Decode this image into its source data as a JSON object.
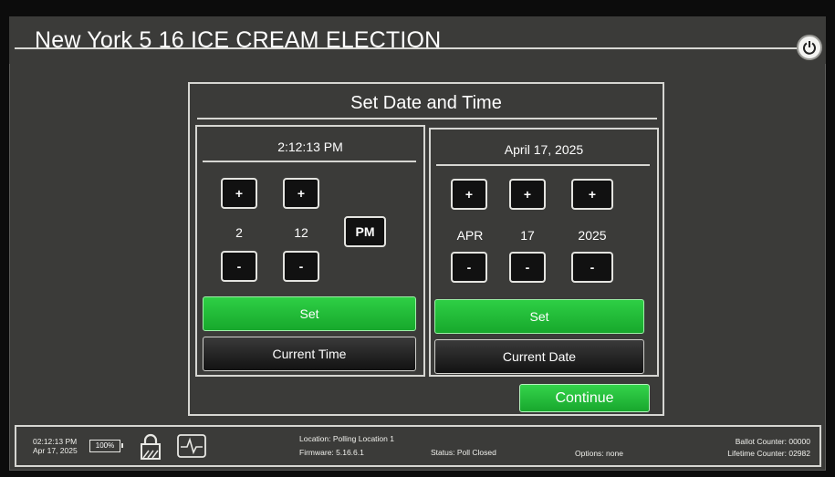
{
  "header": {
    "title": "New York 5 16 ICE CREAM ELECTION",
    "power_icon": "power-icon"
  },
  "dialog": {
    "title": "Set Date and Time",
    "time_panel": {
      "current_value": "2:12:13 PM",
      "hour": "2",
      "minute": "12",
      "ampm": "PM",
      "plus_label": "+",
      "minus_label": "-",
      "set_label": "Set",
      "current_label": "Current Time"
    },
    "date_panel": {
      "current_value": "April 17, 2025",
      "month": "APR",
      "day": "17",
      "year": "2025",
      "plus_label": "+",
      "minus_label": "-",
      "set_label": "Set",
      "current_label": "Current Date"
    },
    "continue_label": "Continue"
  },
  "status_bar": {
    "time": "02:12:13 PM",
    "date": "Apr 17, 2025",
    "battery": "100%",
    "lock_icon": "lock-icon",
    "health_icon": "pulse-icon",
    "location": "Location: Polling Location 1",
    "firmware": "Firmware: 5.16.6.1",
    "status": "Status: Poll Closed",
    "options": "Options: none",
    "ballot_counter": "Ballot Counter: 00000",
    "lifetime_counter": "Lifetime Counter: 02982"
  },
  "colors": {
    "background": "#3b3b39",
    "accent_green": "#22bd38",
    "button_dark": "#121212"
  }
}
